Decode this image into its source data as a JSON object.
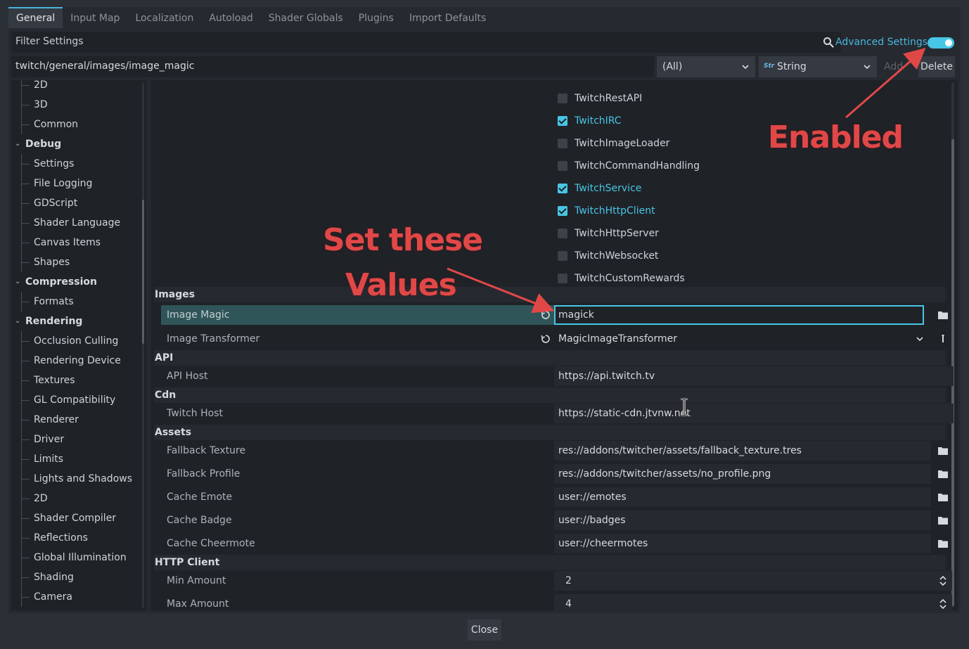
{
  "tabs": [
    "General",
    "Input Map",
    "Localization",
    "Autoload",
    "Shader Globals",
    "Plugins",
    "Import Defaults"
  ],
  "filter": {
    "placeholder": "Filter Settings"
  },
  "advanced": {
    "label": "Advanced Settings",
    "enabled": true
  },
  "path": {
    "value": "twitch/general/images/image_magic"
  },
  "dropdowns": {
    "scope": "(All)",
    "type": "String",
    "type_icon": "Str"
  },
  "buttons": {
    "add": "Add",
    "delete": "Delete",
    "close": "Close"
  },
  "sidebar": [
    {
      "label": "2D",
      "kind": "child"
    },
    {
      "label": "3D",
      "kind": "child"
    },
    {
      "label": "Common",
      "kind": "child"
    },
    {
      "label": "Debug",
      "kind": "section"
    },
    {
      "label": "Settings",
      "kind": "child"
    },
    {
      "label": "File Logging",
      "kind": "child"
    },
    {
      "label": "GDScript",
      "kind": "child"
    },
    {
      "label": "Shader Language",
      "kind": "child"
    },
    {
      "label": "Canvas Items",
      "kind": "child"
    },
    {
      "label": "Shapes",
      "kind": "child"
    },
    {
      "label": "Compression",
      "kind": "section"
    },
    {
      "label": "Formats",
      "kind": "child"
    },
    {
      "label": "Rendering",
      "kind": "section"
    },
    {
      "label": "Occlusion Culling",
      "kind": "child"
    },
    {
      "label": "Rendering Device",
      "kind": "child"
    },
    {
      "label": "Textures",
      "kind": "child"
    },
    {
      "label": "GL Compatibility",
      "kind": "child"
    },
    {
      "label": "Renderer",
      "kind": "child"
    },
    {
      "label": "Driver",
      "kind": "child"
    },
    {
      "label": "Limits",
      "kind": "child"
    },
    {
      "label": "Lights and Shadows",
      "kind": "child"
    },
    {
      "label": "2D",
      "kind": "child"
    },
    {
      "label": "Shader Compiler",
      "kind": "child"
    },
    {
      "label": "Reflections",
      "kind": "child"
    },
    {
      "label": "Global Illumination",
      "kind": "child"
    },
    {
      "label": "Shading",
      "kind": "child"
    },
    {
      "label": "Camera",
      "kind": "child"
    }
  ],
  "checkboxes": [
    {
      "label": "TwitchRestAPI",
      "checked": false
    },
    {
      "label": "TwitchIRC",
      "checked": true
    },
    {
      "label": "TwitchImageLoader",
      "checked": false
    },
    {
      "label": "TwitchCommandHandling",
      "checked": false
    },
    {
      "label": "TwitchService",
      "checked": true
    },
    {
      "label": "TwitchHttpClient",
      "checked": true
    },
    {
      "label": "TwitchHttpServer",
      "checked": false
    },
    {
      "label": "TwitchWebsocket",
      "checked": false
    },
    {
      "label": "TwitchCustomRewards",
      "checked": false
    }
  ],
  "groups": {
    "images": "Images",
    "api": "API",
    "cdn": "Cdn",
    "assets": "Assets",
    "http": "HTTP Client"
  },
  "props": {
    "image_magic": {
      "label": "Image Magic",
      "value": "magick"
    },
    "image_transformer": {
      "label": "Image Transformer",
      "value": "MagicImageTransformer"
    },
    "api_host": {
      "label": "API Host",
      "value": "https://api.twitch.tv"
    },
    "twitch_host": {
      "label": "Twitch Host",
      "value": "https://static-cdn.jtvnw.net"
    },
    "fallback_texture": {
      "label": "Fallback Texture",
      "value": "res://addons/twitcher/assets/fallback_texture.tres"
    },
    "fallback_profile": {
      "label": "Fallback Profile",
      "value": "res://addons/twitcher/assets/no_profile.png"
    },
    "cache_emote": {
      "label": "Cache Emote",
      "value": "user://emotes"
    },
    "cache_badge": {
      "label": "Cache Badge",
      "value": "user://badges"
    },
    "cache_cheermote": {
      "label": "Cache Cheermote",
      "value": "user://cheermotes"
    },
    "min_amount": {
      "label": "Min Amount",
      "value": "2"
    },
    "max_amount": {
      "label": "Max Amount",
      "value": "4"
    }
  },
  "annotations": {
    "enabled": "Enabled",
    "set_line1": "Set these",
    "set_line2": "Values"
  },
  "colors": {
    "accent": "#47c6e6",
    "annotation": "#e04848"
  }
}
